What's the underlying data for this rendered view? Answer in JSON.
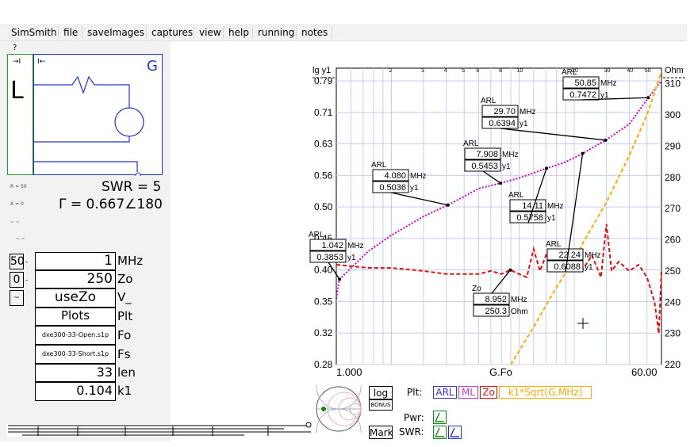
{
  "menu": [
    "SimSmith",
    "file",
    "saveImages",
    "captures",
    "view",
    "help",
    "running",
    "notes"
  ],
  "help_mark": "?",
  "schematic": {
    "left_label": "L",
    "right_label": "G",
    "arrow_left": "→I",
    "arrow_right": "I←",
    "swr_text": "SWR = 5",
    "gamma_text": "Γ = 0.667∠180",
    "r_label": "R = 50",
    "x_label": "X = 0",
    "small_label": "~ ~"
  },
  "params": [
    {
      "value": "1",
      "label": "MHz"
    },
    {
      "value": "250",
      "label": "Zo"
    },
    {
      "value": "useZo",
      "label": "V_"
    },
    {
      "value": "Plots",
      "label": "Plt"
    },
    {
      "value": "dxe300-33-Open.s1p",
      "label": "Fo"
    },
    {
      "value": "dxe300-33-Short.s1p",
      "label": "Fs"
    },
    {
      "value": "33",
      "label": "len"
    },
    {
      "value": "0.104",
      "label": "k1"
    }
  ],
  "side_boxes": [
    "50",
    "0",
    "~"
  ],
  "chart_data": {
    "type": "line",
    "x_scale": "log",
    "xlim": [
      1.0,
      60.0
    ],
    "x_tick_labels": [
      "1.000",
      "G.Fo",
      "60.00"
    ],
    "top_ticks": [
      "2",
      "3",
      "4",
      "5",
      "6",
      "8",
      "10",
      "20",
      "30",
      "40",
      "50"
    ],
    "y_left_label": "lg y1",
    "y_right_label": "Ohm",
    "y_left_ticks": [
      "0.79",
      "0.71",
      "0.63",
      "0.56",
      "0.50",
      "0.45",
      "0.40",
      "0.35",
      "0.32",
      "0.28"
    ],
    "y_right_ticks": [
      "310",
      "300",
      "290",
      "280",
      "270",
      "260",
      "250",
      "240",
      "230",
      "220"
    ],
    "y_right_lim": [
      220,
      315
    ],
    "series": [
      {
        "name": "ARL",
        "color": "#cc00cc",
        "style": "dotted",
        "x": [
          1.0,
          1.04,
          1.5,
          2.0,
          3.0,
          4.08,
          5.0,
          6.0,
          7.9,
          10.0,
          14.11,
          18.0,
          22.24,
          29.7,
          40.0,
          50.85,
          60.0
        ],
        "y": [
          0.355,
          0.3853,
          0.43,
          0.455,
          0.485,
          0.5036,
          0.52,
          0.535,
          0.5453,
          0.555,
          0.5758,
          0.59,
          0.6088,
          0.6394,
          0.68,
          0.7472,
          0.79
        ]
      },
      {
        "name": "Zo",
        "color": "#dd1111",
        "style": "dashed",
        "x": [
          1.0,
          1.5,
          2.0,
          3.0,
          4.0,
          5.0,
          6.0,
          7.0,
          8.0,
          8.952,
          10.0,
          11.0,
          12.0,
          13.0,
          14.0,
          15.0,
          16.0,
          18.0,
          20.0,
          22.0,
          25.0,
          28.0,
          30.0,
          32.0,
          35.0,
          40.0,
          45.0,
          50.0,
          55.0,
          58.0,
          60.0
        ],
        "y": [
          252,
          251,
          251,
          250,
          249,
          249,
          249,
          250,
          249,
          250.3,
          249,
          248,
          257,
          250,
          255,
          251,
          253,
          250,
          252,
          250,
          255,
          248,
          265,
          250,
          253,
          250,
          252,
          248,
          240,
          230,
          250
        ]
      },
      {
        "name": "k1*Sqrt(G.MHz)",
        "color": "#ffaa00",
        "style": "dashed",
        "x": [
          9.0,
          12.0,
          15.0,
          20.0,
          25.0,
          30.0,
          40.0,
          50.0,
          60.0
        ],
        "y": [
          220,
          232,
          242,
          254,
          264,
          272,
          287,
          300,
          314
        ]
      }
    ],
    "markers": [
      {
        "title": "ARL",
        "freq": "1.042",
        "val": "0.3853",
        "unit": "y1",
        "freq_unit": "MHz"
      },
      {
        "title": "ARL",
        "freq": "4.080",
        "val": "0.5036",
        "unit": "y1",
        "freq_unit": "MHz"
      },
      {
        "title": "ARL",
        "freq": "7.908",
        "val": "0.5453",
        "unit": "y1",
        "freq_unit": "MHz"
      },
      {
        "title": "ARL",
        "freq": "29.70",
        "val": "0.6394",
        "unit": "y1",
        "freq_unit": "MHz"
      },
      {
        "title": "ARL",
        "freq": "14.11",
        "val": "0.5758",
        "unit": "y1",
        "freq_unit": "MHz"
      },
      {
        "title": "ARL",
        "freq": "22.24",
        "val": "0.6088",
        "unit": "y1",
        "freq_unit": "MHz"
      },
      {
        "title": "ARL",
        "freq": "50.85",
        "val": "0.7472",
        "unit": "y1",
        "freq_unit": "MHz"
      },
      {
        "title": "Zo",
        "freq": "8.952",
        "val": "250.3",
        "unit": "Ohm",
        "freq_unit": "MHz"
      }
    ]
  },
  "bottom": {
    "log_btn": "log",
    "bonus_btn": "BONUS",
    "mark_btn": "Mark",
    "plt_label": "Plt:",
    "pwr_label": "Pwr:",
    "swr_label": "SWR:",
    "legend": [
      {
        "text": "ARL",
        "color": "#3333cc"
      },
      {
        "text": "ML",
        "color": "#cc33cc"
      },
      {
        "text": "Zo",
        "color": "#dd1111"
      },
      {
        "text": "k1*Sqrt(G.MHz)",
        "color": "#ffaa00"
      }
    ]
  }
}
